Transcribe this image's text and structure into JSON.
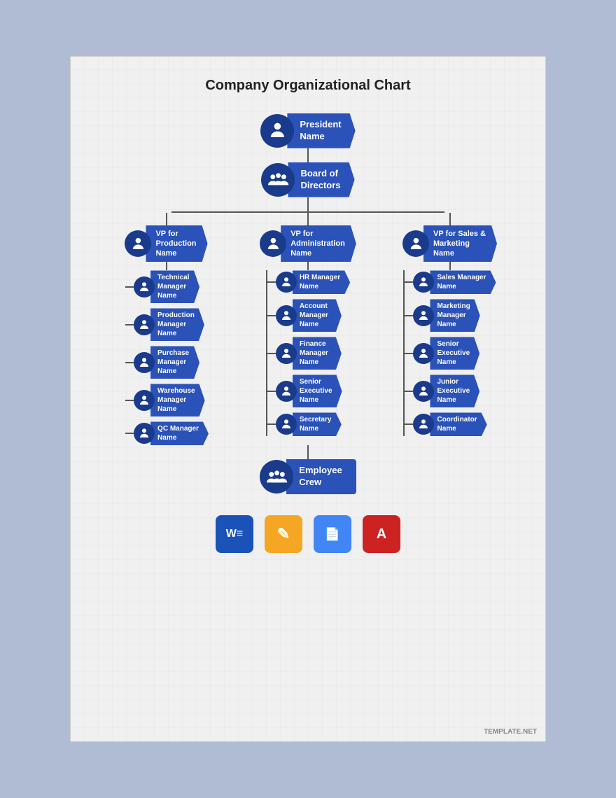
{
  "page": {
    "title": "Company Organizational Chart",
    "watermark": "TEMPLATE.NET"
  },
  "chart": {
    "president": {
      "role": "President",
      "name": "Name"
    },
    "board": {
      "role": "Board of",
      "role2": "Directors"
    },
    "columns": [
      {
        "vp": {
          "role": "VP for",
          "role2": "Production",
          "name": "Name"
        },
        "reports": [
          {
            "role": "Technical",
            "role2": "Manager",
            "name": "Name"
          },
          {
            "role": "Production",
            "role2": "Manager",
            "name": "Name"
          },
          {
            "role": "Purchase",
            "role2": "Manager",
            "name": "Name"
          },
          {
            "role": "Warehouse",
            "role2": "Manager",
            "name": "Name"
          },
          {
            "role": "QC Manager",
            "name": "Name"
          }
        ]
      },
      {
        "vp": {
          "role": "VP for",
          "role2": "Administration",
          "name": "Name"
        },
        "reports": [
          {
            "role": "HR Manager",
            "name": "Name"
          },
          {
            "role": "Account",
            "role2": "Manager",
            "name": "Name"
          },
          {
            "role": "Finance",
            "role2": "Manager",
            "name": "Name"
          },
          {
            "role": "Senior",
            "role2": "Executive",
            "name": "Name"
          },
          {
            "role": "Secretary",
            "name": "Name"
          }
        ]
      },
      {
        "vp": {
          "role": "VP for Sales &",
          "role2": "Marketing",
          "name": "Name"
        },
        "reports": [
          {
            "role": "Sales Manager",
            "name": "Name"
          },
          {
            "role": "Marketing",
            "role2": "Manager",
            "name": "Name"
          },
          {
            "role": "Senior",
            "role2": "Executive",
            "name": "Name"
          },
          {
            "role": "Junior",
            "role2": "Executive",
            "name": "Name"
          },
          {
            "role": "Coordinator",
            "name": "Name"
          }
        ]
      }
    ],
    "employee": {
      "role": "Employee",
      "role2": "Crew"
    }
  },
  "footer": {
    "word_label": "W",
    "pages_label": "✎",
    "gdocs_label": "≡",
    "acrobat_label": "A"
  }
}
